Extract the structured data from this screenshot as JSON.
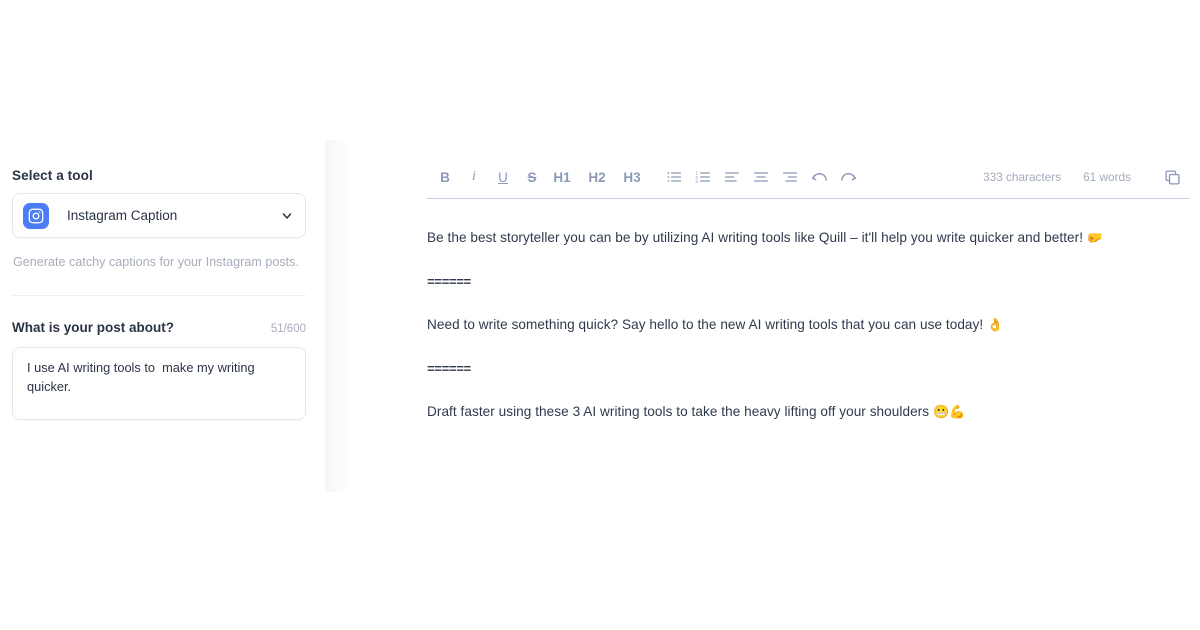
{
  "sidebar": {
    "section_title": "Select a tool",
    "tool_select": {
      "icon": "instagram-icon",
      "value": "Instagram Caption",
      "chevron": "chevron-down-icon",
      "accent_color": "#4a7cf7"
    },
    "tool_description": "Generate catchy captions for your Instagram posts.",
    "prompt_field": {
      "label": "What is your post about?",
      "counter": "51/600",
      "value": "I use AI writing tools to  make my writing quicker.",
      "placeholder": ""
    }
  },
  "editor": {
    "toolbar": {
      "bold": "B",
      "italic": "i",
      "underline": "U",
      "strikethrough": "S",
      "h1": "H1",
      "h2": "H2",
      "h3": "H3",
      "bullet_list": "bullet-list-icon",
      "numbered_list": "numbered-list-icon",
      "align_left": "align-left-icon",
      "align_center": "align-center-icon",
      "align_right": "align-right-icon",
      "undo": "undo-icon",
      "redo": "redo-icon",
      "character_count": "333 characters",
      "word_count": "61 words",
      "copy": "copy-icon"
    },
    "content": [
      {
        "type": "paragraph",
        "text": "Be the best storyteller you can be by utilizing AI writing tools like Quill – it'll help you write quicker and better! ",
        "emoji": "🤛"
      },
      {
        "type": "separator",
        "text": "======",
        "emoji": ""
      },
      {
        "type": "paragraph",
        "text": "Need to write something quick? Say hello to the new AI writing tools that you can use today! ",
        "emoji": "👌"
      },
      {
        "type": "separator",
        "text": "======",
        "emoji": ""
      },
      {
        "type": "paragraph",
        "text": "Draft faster using these 3 AI writing tools to take the heavy lifting off your shoulders ",
        "emoji": "😬💪"
      }
    ]
  }
}
